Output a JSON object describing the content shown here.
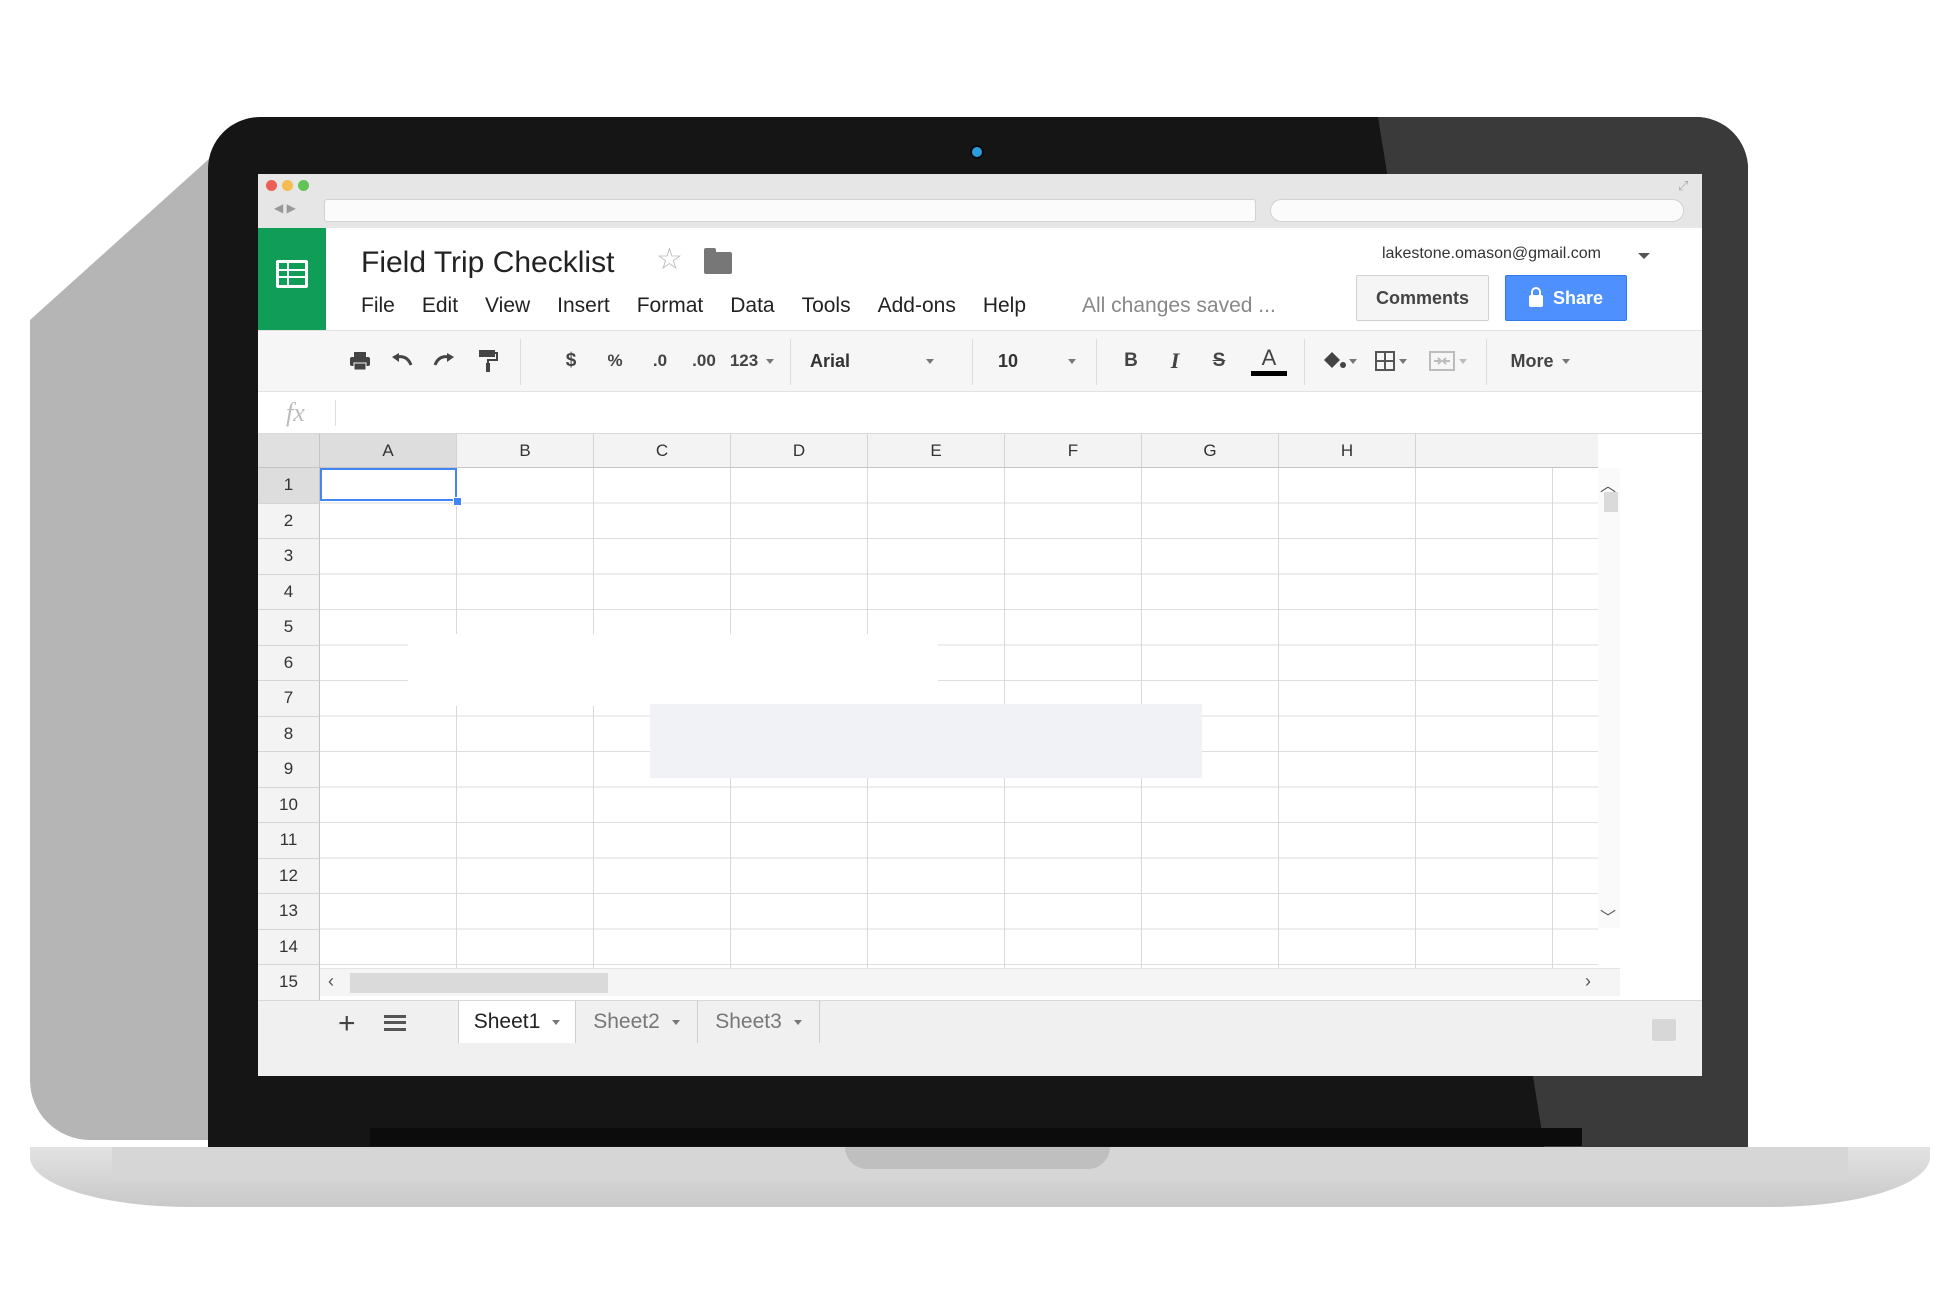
{
  "doc": {
    "title": "Field Trip Checklist",
    "status": "All changes saved ...",
    "account": "lakestone.omason@gmail.com"
  },
  "menu": [
    "File",
    "Edit",
    "View",
    "Insert",
    "Format",
    "Data",
    "Tools",
    "Add-ons",
    "Help"
  ],
  "buttons": {
    "comments": "Comments",
    "share": "Share"
  },
  "toolbar": {
    "currency": "$",
    "percent": "%",
    "decrease_decimals": ".0",
    "increase_decimals": ".00",
    "more_formats": "123",
    "font": "Arial",
    "font_size": "10",
    "bold": "B",
    "italic": "I",
    "strike": "S",
    "text_color": "A",
    "more": "More"
  },
  "formula_bar": {
    "fx": "fx",
    "value": ""
  },
  "grid": {
    "columns": [
      "A",
      "B",
      "C",
      "D",
      "E",
      "F",
      "G",
      "H"
    ],
    "rows": [
      "1",
      "2",
      "3",
      "4",
      "5",
      "6",
      "7",
      "8",
      "9",
      "10",
      "11",
      "12",
      "13",
      "14",
      "15"
    ],
    "active_cell": "A1"
  },
  "sheets": [
    "Sheet1",
    "Sheet2",
    "Sheet3"
  ],
  "icons": [
    "print-icon",
    "undo-icon",
    "redo-icon",
    "paint-format-icon",
    "fill-color-icon",
    "borders-icon",
    "merge-icon",
    "star-icon",
    "folder-icon",
    "lock-icon"
  ],
  "colors": {
    "brand": "#0f9d58",
    "share": "#4d90fe",
    "selection": "#4285f4"
  }
}
